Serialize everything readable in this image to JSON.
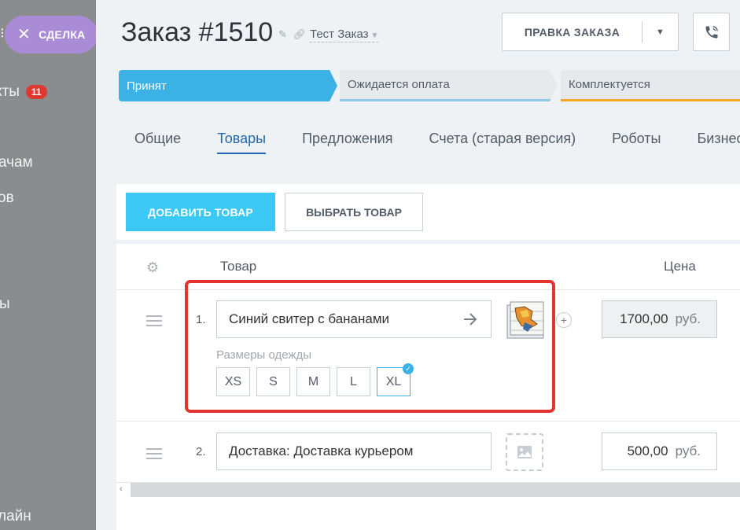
{
  "sidebar_overlay": {
    "close_label": "СДЕЛКА",
    "items": [
      {
        "label": "кты",
        "badge": "11"
      },
      {
        "label": "ачам"
      },
      {
        "label": "ов"
      },
      {
        "label": "ы"
      },
      {
        "label": "лайн"
      }
    ]
  },
  "header": {
    "title": "Заказ  #1510",
    "subtitle": "Тест Заказ",
    "edit_button": "ПРАВКА ЗАКАЗА"
  },
  "stages": [
    {
      "label": "Принят"
    },
    {
      "label": "Ожидается оплата"
    },
    {
      "label": "Комплектуется"
    }
  ],
  "tabs": [
    {
      "label": "Общие"
    },
    {
      "label": "Товары"
    },
    {
      "label": "Предложения"
    },
    {
      "label": "Счета (старая версия)"
    },
    {
      "label": "Роботы"
    },
    {
      "label": "Бизнес"
    }
  ],
  "active_tab": "Товары",
  "toolbar": {
    "add_label": "ДОБАВИТЬ ТОВАР",
    "choose_label": "ВЫБРАТЬ ТОВАР"
  },
  "table": {
    "col_product": "Товар",
    "col_price": "Цена",
    "rows": [
      {
        "num": "1.",
        "name": "Синий свитер с бананами",
        "price": "1700,00",
        "currency": "руб.",
        "prop_label": "Размеры одежды",
        "sizes": [
          "XS",
          "S",
          "M",
          "L",
          "XL"
        ],
        "selected_size": "XL"
      },
      {
        "num": "2.",
        "name": "Доставка: Доставка курьером",
        "price": "500,00",
        "currency": "руб."
      }
    ]
  },
  "colors": {
    "accent_blue": "#3bb1e6",
    "add_button": "#3bc8f5",
    "highlight_red": "#e3342f",
    "stage_orange": "#f5a623",
    "close_pill": "#a98bd6"
  }
}
